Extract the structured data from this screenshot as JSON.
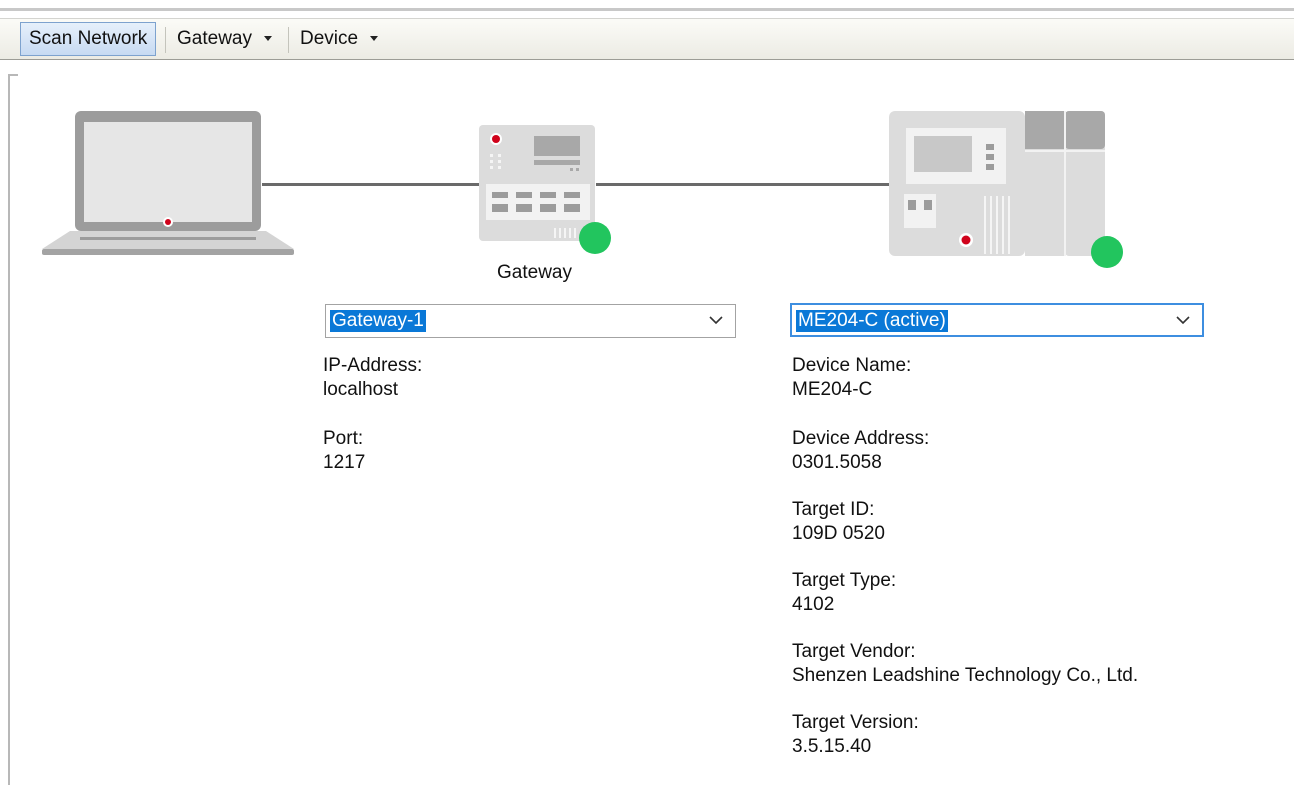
{
  "toolbar": {
    "scan_label": "Scan Network",
    "gateway_label": "Gateway",
    "device_label": "Device"
  },
  "topology": {
    "gateway_caption": "Gateway",
    "status_color": "#22c55e"
  },
  "gateway_panel": {
    "select_value": "Gateway-1",
    "fields": [
      {
        "label": "IP-Address:",
        "value": "localhost"
      },
      {
        "label": "Port:",
        "value": "1217"
      }
    ]
  },
  "device_panel": {
    "select_value": "ME204-C (active)",
    "fields": [
      {
        "label": "Device Name:",
        "value": "ME204-C"
      },
      {
        "label": "Device Address:",
        "value": "0301.5058"
      },
      {
        "label": "Target ID:",
        "value": "109D 0520"
      },
      {
        "label": "Target Type:",
        "value": "4102"
      },
      {
        "label": "Target Vendor:",
        "value": "Shenzen Leadshine Technology Co., Ltd."
      },
      {
        "label": "Target Version:",
        "value": "3.5.15.40"
      }
    ]
  }
}
